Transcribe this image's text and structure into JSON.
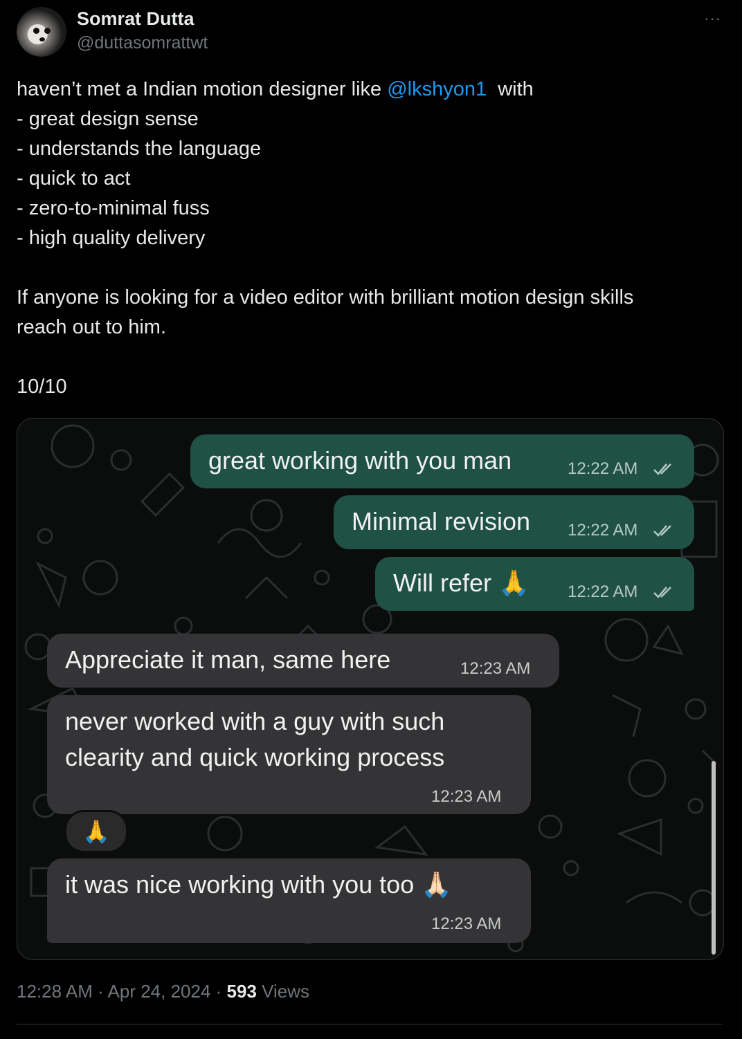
{
  "author": {
    "name": "Somrat Dutta",
    "handle": "@duttasomrattwt"
  },
  "more_label": "···",
  "tweet": {
    "line1_pre": "haven’t met a Indian motion designer like ",
    "mention": "@lkshyon1",
    "line1_post": "  with",
    "bullets": [
      "- great design sense",
      "- understands the language",
      "- quick to act",
      "- zero-to-minimal fuss",
      "- high quality delivery"
    ],
    "para1": "If anyone is looking for a video editor with brilliant motion design skills",
    "para2": "reach out to him.",
    "rating": "10/10"
  },
  "chat": {
    "messages": [
      {
        "direction": "outgoing",
        "text": "great working with you man",
        "time": "12:22 AM",
        "read": true
      },
      {
        "direction": "outgoing",
        "text": "Minimal revision",
        "time": "12:22 AM",
        "read": true
      },
      {
        "direction": "outgoing",
        "text": "Will refer 🙏",
        "time": "12:22 AM",
        "read": true
      },
      {
        "direction": "incoming",
        "text": "Appreciate it man, same here",
        "time": "12:23 AM"
      },
      {
        "direction": "incoming",
        "lines": [
          "never worked with a guy with such",
          "clearity and quick working process"
        ],
        "time": "12:23 AM",
        "reaction": "🙏"
      },
      {
        "direction": "incoming",
        "text": "it was nice working with you too 🙏🏻",
        "time": "12:23 AM"
      }
    ]
  },
  "footer": {
    "time": "12:28 AM",
    "separator": " · ",
    "date": "Apr 24, 2024",
    "views_count": "593",
    "views_label": "Views"
  },
  "colors": {
    "background": "#000000",
    "text": "#e7e9ea",
    "muted": "#71767b",
    "link": "#1d9bf0",
    "outgoing_bubble": "#1f5145",
    "incoming_bubble": "#343436",
    "read_tick": "#b6c9c3"
  }
}
